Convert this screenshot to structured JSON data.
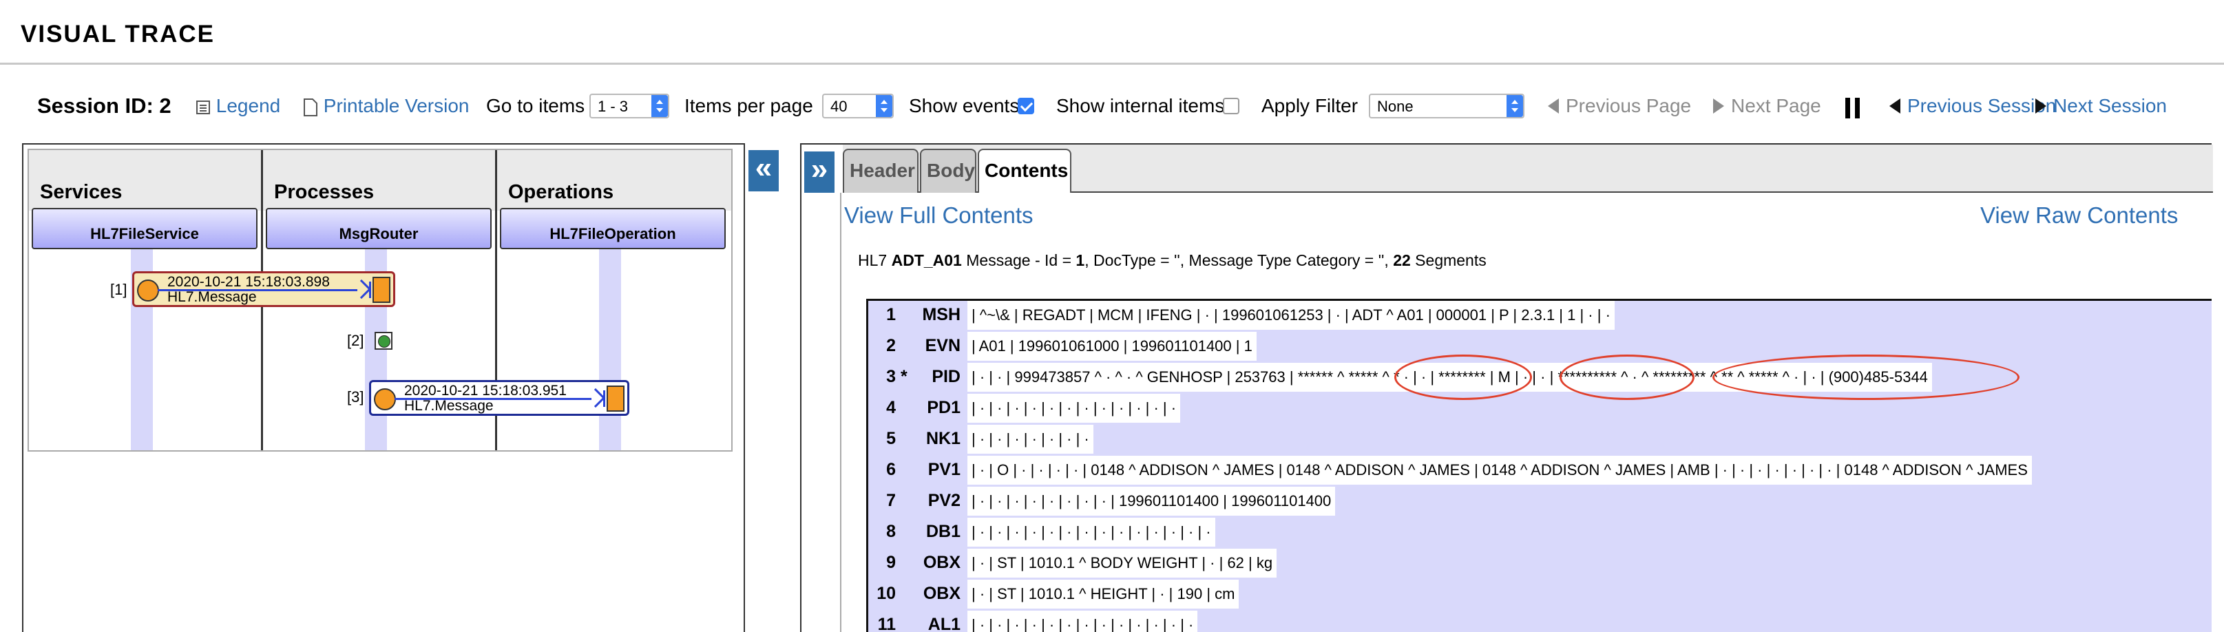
{
  "page": {
    "title": "VISUAL TRACE"
  },
  "toolbar": {
    "session_id": "Session ID: 2",
    "legend": "Legend",
    "printable": "Printable Version",
    "goto_label": "Go to items",
    "goto_value": "1 - 3",
    "per_page_label": "Items per page",
    "per_page_value": "40",
    "show_events_label": "Show events",
    "show_events_checked": true,
    "show_internal_label": "Show internal items",
    "show_internal_checked": false,
    "apply_filter_label": "Apply Filter",
    "filter_value": "None",
    "prev_page": "Previous Page",
    "next_page": "Next Page",
    "prev_session": "Previous Session",
    "next_session": "Next Session"
  },
  "diagram": {
    "columns": [
      {
        "title": "Services",
        "host": "HL7FileService"
      },
      {
        "title": "Processes",
        "host": "MsgRouter"
      },
      {
        "title": "Operations",
        "host": "HL7FileOperation"
      }
    ],
    "messages": [
      {
        "index": "[1]",
        "time": "2020-10-21 15:18:03.898",
        "type": "HL7.Message"
      },
      {
        "index": "[2]"
      },
      {
        "index": "[3]",
        "time": "2020-10-21 15:18:03.951",
        "type": "HL7.Message"
      }
    ]
  },
  "panel": {
    "collapse_left": "«",
    "expand_right": "»",
    "tabs": [
      "Header",
      "Body",
      "Contents"
    ],
    "active_tab": "Contents",
    "view_full": "View Full Contents",
    "view_raw": "View Raw Contents",
    "summary": {
      "prefix": "HL7 ",
      "doctype": "ADT_A01",
      "mid1": " Message - Id = ",
      "id": "1",
      "mid2": ", DocType = '', Message Type Category = '', ",
      "segments": "22",
      "suffix": " Segments"
    }
  },
  "segments": [
    {
      "num": "1",
      "mark": "",
      "name": "MSH",
      "data": "| ^~\\& | REGADT | MCM | IFENG | · | 199601061253 | · | ADT ^ A01 | 000001 | P | 2.3.1 | 1 | · | ·"
    },
    {
      "num": "2",
      "mark": "",
      "name": "EVN",
      "data": "| A01 | 199601061000 | 199601101400 | 1"
    },
    {
      "num": "3",
      "mark": "*",
      "name": "PID",
      "data": "| · | · | 999473857 ^ · ^ · ^ GENHOSP | 253763 | ****** ^ ***** ^ * · | · | ******** | M | · | · | ********** ^ · ^ ********* ^ ** ^ ***** ^ · | · | (900)485-5344"
    },
    {
      "num": "4",
      "mark": "",
      "name": "PD1",
      "data": "| · | · | · | · | · | · | · | · | · | · | · | ·"
    },
    {
      "num": "5",
      "mark": "",
      "name": "NK1",
      "data": "| · | · | · | · | · | · | ·"
    },
    {
      "num": "6",
      "mark": "",
      "name": "PV1",
      "data": "| · | O | · | · | · | · | 0148 ^ ADDISON ^ JAMES | 0148 ^ ADDISON ^ JAMES | 0148 ^ ADDISON ^ JAMES | AMB | · | · | · | · | · | · | · | 0148 ^ ADDISON ^ JAMES"
    },
    {
      "num": "7",
      "mark": "",
      "name": "PV2",
      "data": "| · | · | · | · | · | · | · | · | 199601101400 | 199601101400"
    },
    {
      "num": "8",
      "mark": "",
      "name": "DB1",
      "data": "| · | · | · | · | · | · | · | · | · | · | · | · | · | ·"
    },
    {
      "num": "9",
      "mark": "",
      "name": "OBX",
      "data": "| · | ST | 1010.1 ^ BODY WEIGHT | · | 62 | kg"
    },
    {
      "num": "10",
      "mark": "",
      "name": "OBX",
      "data": "| · | ST | 1010.1 ^ HEIGHT | · | 190 | cm"
    },
    {
      "num": "11",
      "mark": "",
      "name": "AL1",
      "data": "| · | · | · | · | · | · | · | · | · | · | · | · | ·"
    }
  ]
}
